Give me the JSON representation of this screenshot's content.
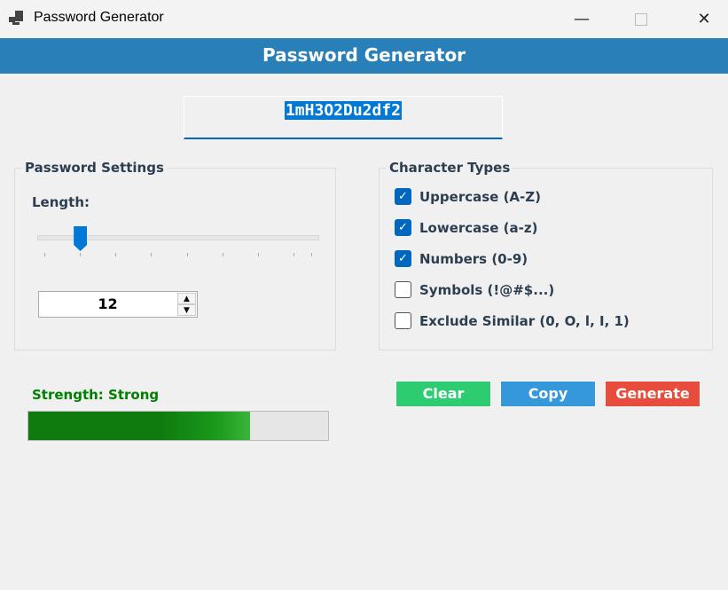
{
  "window": {
    "title": "Password Generator",
    "icon": "app-icon",
    "controls": [
      "minimize-icon",
      "maximize-icon",
      "close-icon"
    ]
  },
  "header": {
    "title": "Password Generator"
  },
  "password": {
    "value": "1mH3O2Du2df2"
  },
  "settings": {
    "legend": "Password Settings",
    "length_label": "Length:",
    "length_value": "12",
    "slider_fraction": 0.133
  },
  "char_types": {
    "legend": "Character Types",
    "options": [
      {
        "label": "Uppercase (A-Z)",
        "checked": true
      },
      {
        "label": "Lowercase (a-z)",
        "checked": true
      },
      {
        "label": "Numbers (0-9)",
        "checked": true
      },
      {
        "label": "Symbols (!@#$...)",
        "checked": false
      },
      {
        "label": "Exclude Similar (0, O, l, I, 1)",
        "checked": false
      }
    ]
  },
  "strength": {
    "label": "Strength: Strong",
    "percent": 74,
    "color": "#008000"
  },
  "buttons": {
    "clear": "Clear",
    "copy": "Copy",
    "generate": "Generate"
  },
  "colors": {
    "header": "#2980b9",
    "clear": "#2ecc71",
    "copy": "#3498db",
    "generate": "#e74c3c"
  }
}
